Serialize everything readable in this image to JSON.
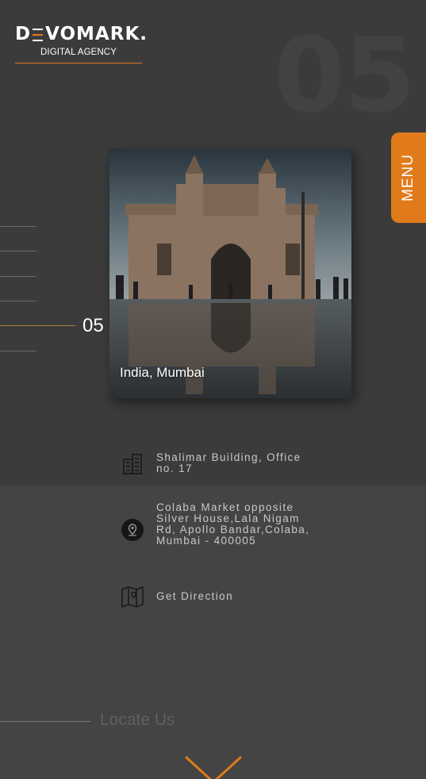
{
  "brand": {
    "logo_prefix": "D",
    "logo_suffix": "VOMARK.",
    "tagline": "DIGITAL AGENCY",
    "accent_color": "#e07a1a"
  },
  "background_number": "05",
  "menu": {
    "label": "MENU"
  },
  "slider": {
    "current": "05",
    "total_lines": 6,
    "active_index": 4
  },
  "location_card": {
    "caption": "India, Mumbai",
    "image": "gateway-of-india-photo"
  },
  "contact": {
    "building": {
      "icon": "building-icon",
      "text": "Shalimar Building, Office no. 17"
    },
    "address": {
      "icon": "location-pin-icon",
      "text": "Colaba Market opposite Silver House,Lala Nigam Rd, Apollo Bandar,Colaba, Mumbai - 400005"
    },
    "direction": {
      "icon": "map-icon",
      "text": "Get Direction"
    }
  },
  "footer": {
    "locate_label": "Locate Us",
    "scroll_icon": "chevron-down-icon"
  }
}
